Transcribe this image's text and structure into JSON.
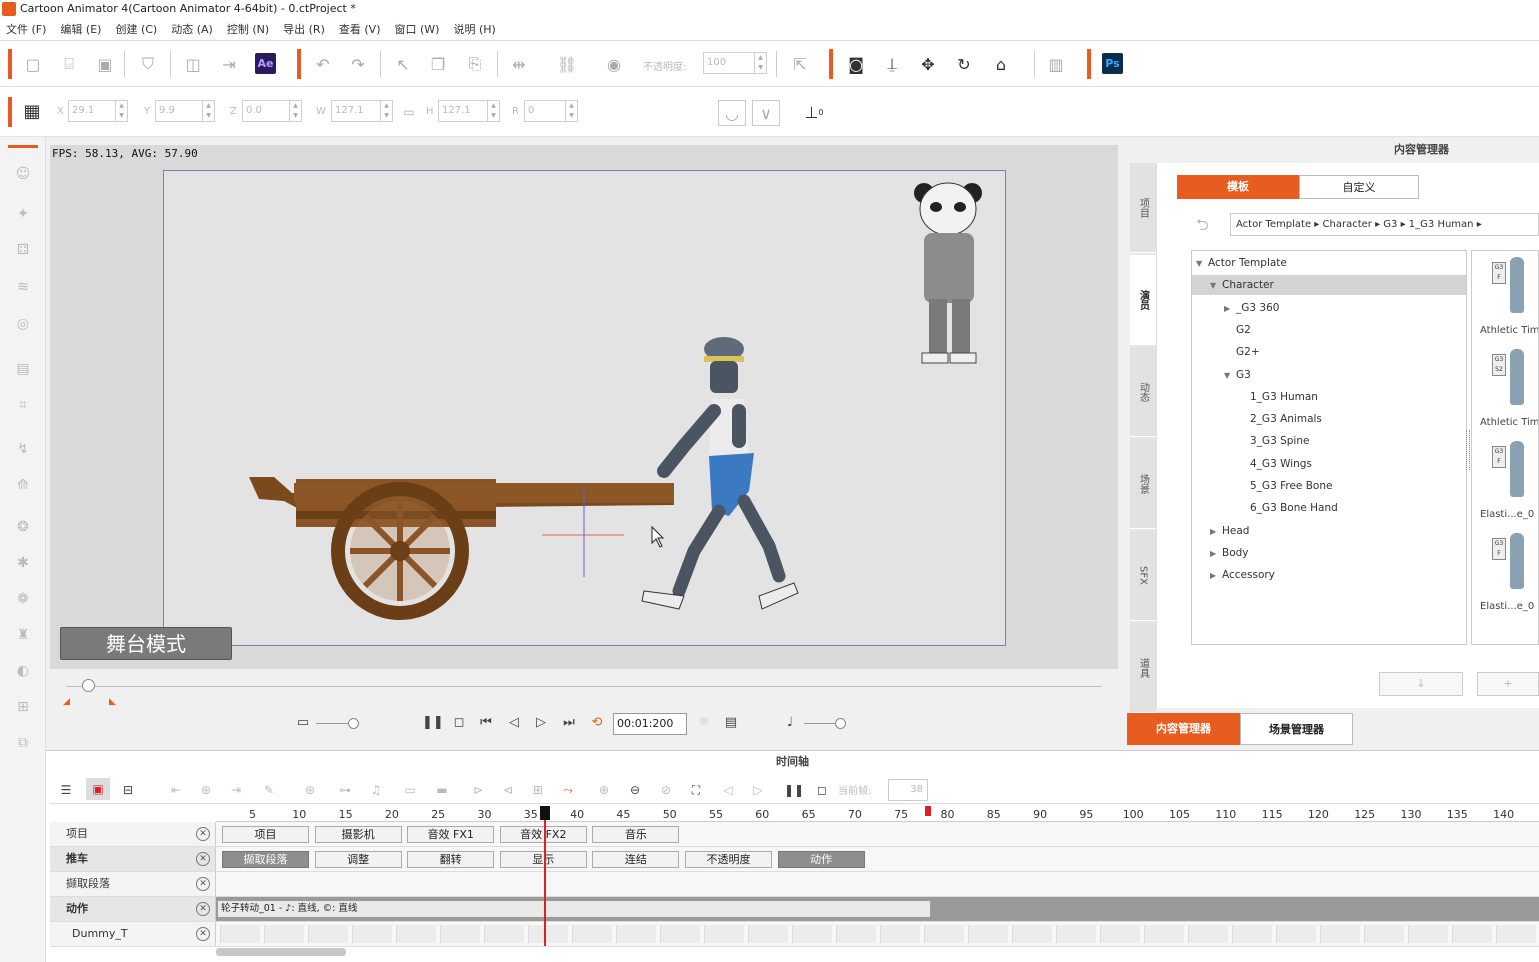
{
  "window": {
    "title": "Cartoon Animator 4(Cartoon Animator 4-64bit) - 0.ctProject *"
  },
  "menu": [
    "文件 (F)",
    "编辑 (E)",
    "创建 (C)",
    "动态 (A)",
    "控制 (N)",
    "导出 (R)",
    "查看 (V)",
    "窗口 (W)",
    "说明 (H)"
  ],
  "toolbar1": {
    "ae_label": "Ae",
    "ps_label": "Ps",
    "opacity_label": "不透明度:",
    "opacity_value": "100"
  },
  "toolbar2": {
    "x_label": "X",
    "x_value": "29.1",
    "y_label": "Y",
    "y_value": "9.9",
    "z_label": "Z",
    "z_value": "0.0",
    "w_label": "W",
    "w_value": "127.1",
    "h_label": "H",
    "h_value": "127.1",
    "r_label": "R",
    "r_value": "0",
    "pivot_label": "0"
  },
  "stage": {
    "fps_text": "FPS: 58.13, AVG: 57.90",
    "mode_label": "舞台模式"
  },
  "playback": {
    "time_value": "00:01:200"
  },
  "content_manager": {
    "panel_title": "内容管理器",
    "side_tabs": [
      "项目",
      "演员",
      "动态",
      "场景",
      "SFX",
      "道具"
    ],
    "active_side_tab": "演员",
    "tab_template": "模板",
    "tab_custom": "自定义",
    "breadcrumb": [
      "Actor Template",
      "Character",
      "G3",
      "1_G3 Human"
    ],
    "tree": [
      {
        "label": "Actor Template",
        "depth": 0,
        "expanded": true
      },
      {
        "label": "Character",
        "depth": 1,
        "expanded": true,
        "selected": true
      },
      {
        "label": "_G3 360",
        "depth": 2,
        "expanded": false
      },
      {
        "label": "G2",
        "depth": 2,
        "leaf": true
      },
      {
        "label": "G2+",
        "depth": 2,
        "leaf": true
      },
      {
        "label": "G3",
        "depth": 2,
        "expanded": true
      },
      {
        "label": "1_G3 Human",
        "depth": 3,
        "leaf": true
      },
      {
        "label": "2_G3 Animals",
        "depth": 3,
        "leaf": true
      },
      {
        "label": "3_G3 Spine",
        "depth": 3,
        "leaf": true
      },
      {
        "label": "4_G3 Wings",
        "depth": 3,
        "leaf": true
      },
      {
        "label": "5_G3 Free Bone",
        "depth": 3,
        "leaf": true
      },
      {
        "label": "6_G3 Bone Hand",
        "depth": 3,
        "leaf": true
      },
      {
        "label": "Head",
        "depth": 1,
        "expanded": false
      },
      {
        "label": "Body",
        "depth": 1,
        "expanded": false
      },
      {
        "label": "Accessory",
        "depth": 1,
        "expanded": false
      }
    ],
    "thumbnails": [
      {
        "label": "Athletic Tim",
        "tag": "G3 F"
      },
      {
        "label": "Athletic Tim_",
        "tag": "G3 S2"
      },
      {
        "label": "Elasti...e_0",
        "tag": "G3 F"
      },
      {
        "label": "Elasti...e_0",
        "tag": "G3 F"
      }
    ],
    "bottom_tab_content": "内容管理器",
    "bottom_tab_scene": "场景管理器"
  },
  "timeline": {
    "title": "时间轴",
    "current_frame_label": "当前帧:",
    "current_frame_value": "38",
    "ruler_ticks": [
      "5",
      "10",
      "15",
      "20",
      "25",
      "30",
      "35",
      "40",
      "45",
      "50",
      "55",
      "60",
      "65",
      "70",
      "75",
      "80",
      "85",
      "90",
      "95",
      "100",
      "105",
      "110",
      "115",
      "120",
      "125",
      "130",
      "135",
      "140"
    ],
    "tracks": [
      {
        "name": "项目",
        "bold": false,
        "chips": [
          "项目",
          "摄影机",
          "音效 FX1",
          "音效 FX2",
          "音乐"
        ]
      },
      {
        "name": "推车",
        "bold": true,
        "chips": [
          "撷取段落",
          "调整",
          "翻转",
          "显示",
          "连结",
          "不透明度",
          "动作"
        ]
      },
      {
        "name": "撷取段落",
        "bold": false,
        "chips": []
      },
      {
        "name": "动作",
        "bold": true,
        "clip_text": "轮子转动_01 - ♪: 直线, ©: 直线"
      },
      {
        "name": "Dummy_T",
        "bold": false,
        "chips": []
      }
    ]
  },
  "colors": {
    "accent": "#e85d1f",
    "stage_bg": "#d9d9d9",
    "stage_frame": "#6b86b0",
    "playhead": "#e02020"
  }
}
